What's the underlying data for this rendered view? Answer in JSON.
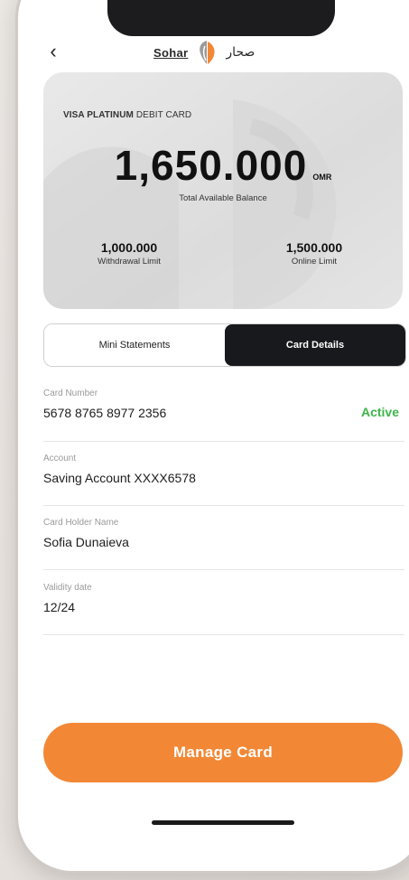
{
  "header": {
    "back_symbol": "‹",
    "logo_en": "Sohar",
    "logo_ar": "صحار"
  },
  "card": {
    "type_bold": "VISA PLATINUM",
    "type_light": "DEBIT CARD",
    "balance_amount": "1,650.000",
    "balance_currency": "OMR",
    "balance_label": "Total Available Balance",
    "withdrawal_limit": {
      "value": "1,000.000",
      "label": "Withdrawal Limit"
    },
    "online_limit": {
      "value": "1,500.000",
      "label": "Online Limit"
    }
  },
  "tabs": [
    {
      "label": "Mini Statements",
      "active": false
    },
    {
      "label": "Card Details",
      "active": true
    }
  ],
  "details": [
    {
      "label": "Card Number",
      "value": "5678 8765 8977 2356",
      "status": "Active"
    },
    {
      "label": "Account",
      "value": "Saving Account XXXX6578"
    },
    {
      "label": "Card Holder Name",
      "value": "Sofia Dunaieva"
    },
    {
      "label": "Validity date",
      "value": "12/24"
    }
  ],
  "actions": {
    "manage_card_label": "Manage Card"
  },
  "colors": {
    "accent": "#f28735",
    "active_status": "#3db54a",
    "tab_active_bg": "#17191c"
  },
  "icons": {
    "back": "chevron-left-icon",
    "logo_mark": "sohar-logo-icon"
  }
}
